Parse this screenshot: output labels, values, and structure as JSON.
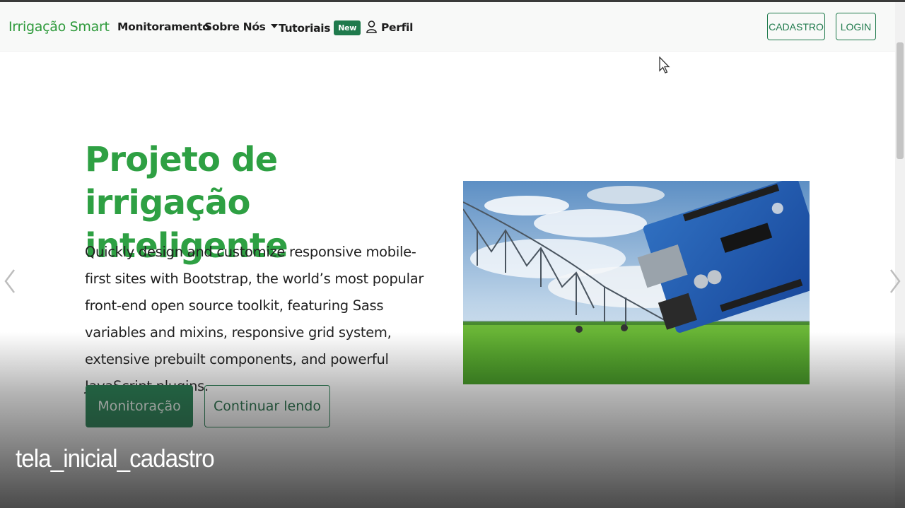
{
  "navbar": {
    "brand": "Irrigação Smart",
    "links": {
      "monitoramento": "Monitoramento",
      "sobre": "Sobre Nós",
      "tutoriais": "Tutoriais",
      "tutoriais_badge": "New",
      "perfil": "Perfil"
    },
    "buttons": {
      "cadastro": "CADASTRO",
      "login": "LOGIN"
    }
  },
  "hero": {
    "title": "Projeto de irrigação inteligente",
    "text": "Quickly design and customize responsive mobile-first sites with Bootstrap, the world’s most popular front-end open source toolkit, featuring Sass variables and mixins, responsive grid system, extensive prebuilt components, and powerful JavaScript plugins.",
    "primary_button": "Monitoração",
    "secondary_button": "Continuar lendo"
  },
  "caption": "tela_inicial_cadastro",
  "colors": {
    "brand_green": "#2ea043",
    "button_green": "#1f7a4c"
  },
  "icons": [
    "user-icon",
    "chevron-left-icon",
    "chevron-right-icon",
    "caret-down-icon",
    "mouse-cursor-icon"
  ]
}
